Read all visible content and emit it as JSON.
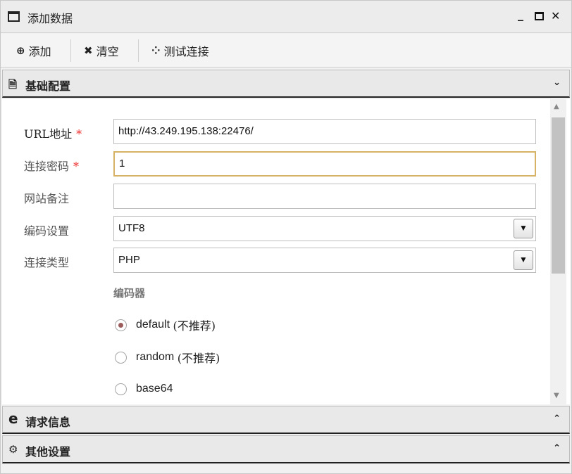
{
  "window": {
    "title": "添加数据"
  },
  "toolbar": {
    "add_label": "添加",
    "clear_label": "清空",
    "test_label": "测试连接"
  },
  "sections": {
    "basic": {
      "label": "基础配置"
    },
    "request": {
      "label": "请求信息"
    },
    "other": {
      "label": "其他设置"
    }
  },
  "form": {
    "url": {
      "label": "URL地址",
      "required": "*",
      "value": "http://43.249.195.138:22476/"
    },
    "password": {
      "label": "连接密码",
      "required": "*",
      "value": "1"
    },
    "note": {
      "label": "网站备注",
      "value": ""
    },
    "encoding": {
      "label": "编码设置",
      "value": "UTF8"
    },
    "type": {
      "label": "连接类型",
      "value": "PHP"
    },
    "encoder": {
      "title": "编码器",
      "options": [
        {
          "name": "default",
          "note": "(不推荐)",
          "selected": true
        },
        {
          "name": "random",
          "note": "(不推荐)",
          "selected": false
        },
        {
          "name": "base64",
          "note": "",
          "selected": false
        }
      ]
    }
  },
  "icons": {
    "window": "window-icon",
    "add": "plus-circle-icon",
    "clear": "x-icon",
    "test": "spinner-icon",
    "basic": "file-icon",
    "request": "ie-icon",
    "other": "gears-icon"
  },
  "colors": {
    "required": "#ee3333",
    "focus_border": "#d6b266",
    "radio_selected": "#9b5b5b"
  }
}
